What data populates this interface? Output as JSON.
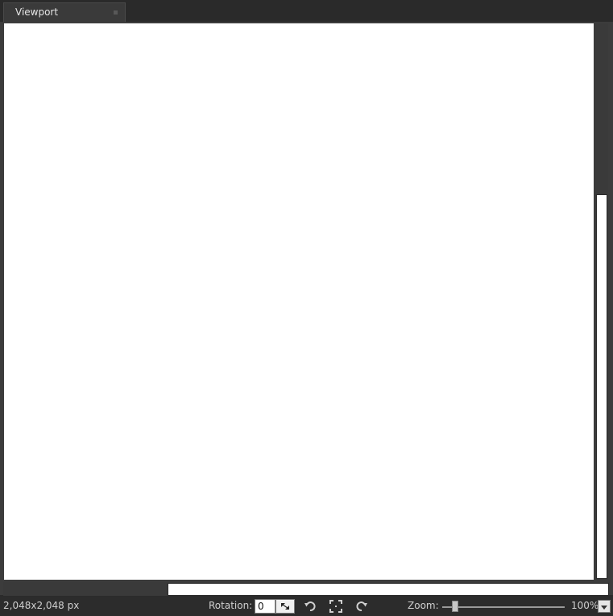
{
  "tab": {
    "label": "Viewport"
  },
  "status": {
    "image_size": "2,048x2,048 px",
    "rotation_label": "Rotation:",
    "rotation_value": "0",
    "zoom_label": "Zoom:",
    "zoom_value": "100%",
    "zoom_slider_fraction": 0.08
  },
  "icons": {
    "spin": "rotation-spin-icon",
    "rotate_left": "rotate-left-icon",
    "fit": "fit-to-view-icon",
    "rotate_right": "rotate-right-icon",
    "zoom_dropdown": "chevron-down-icon"
  },
  "colors": {
    "background": "#2b2b2b",
    "canvas": "#ffffff",
    "text": "#d6d6d6"
  }
}
